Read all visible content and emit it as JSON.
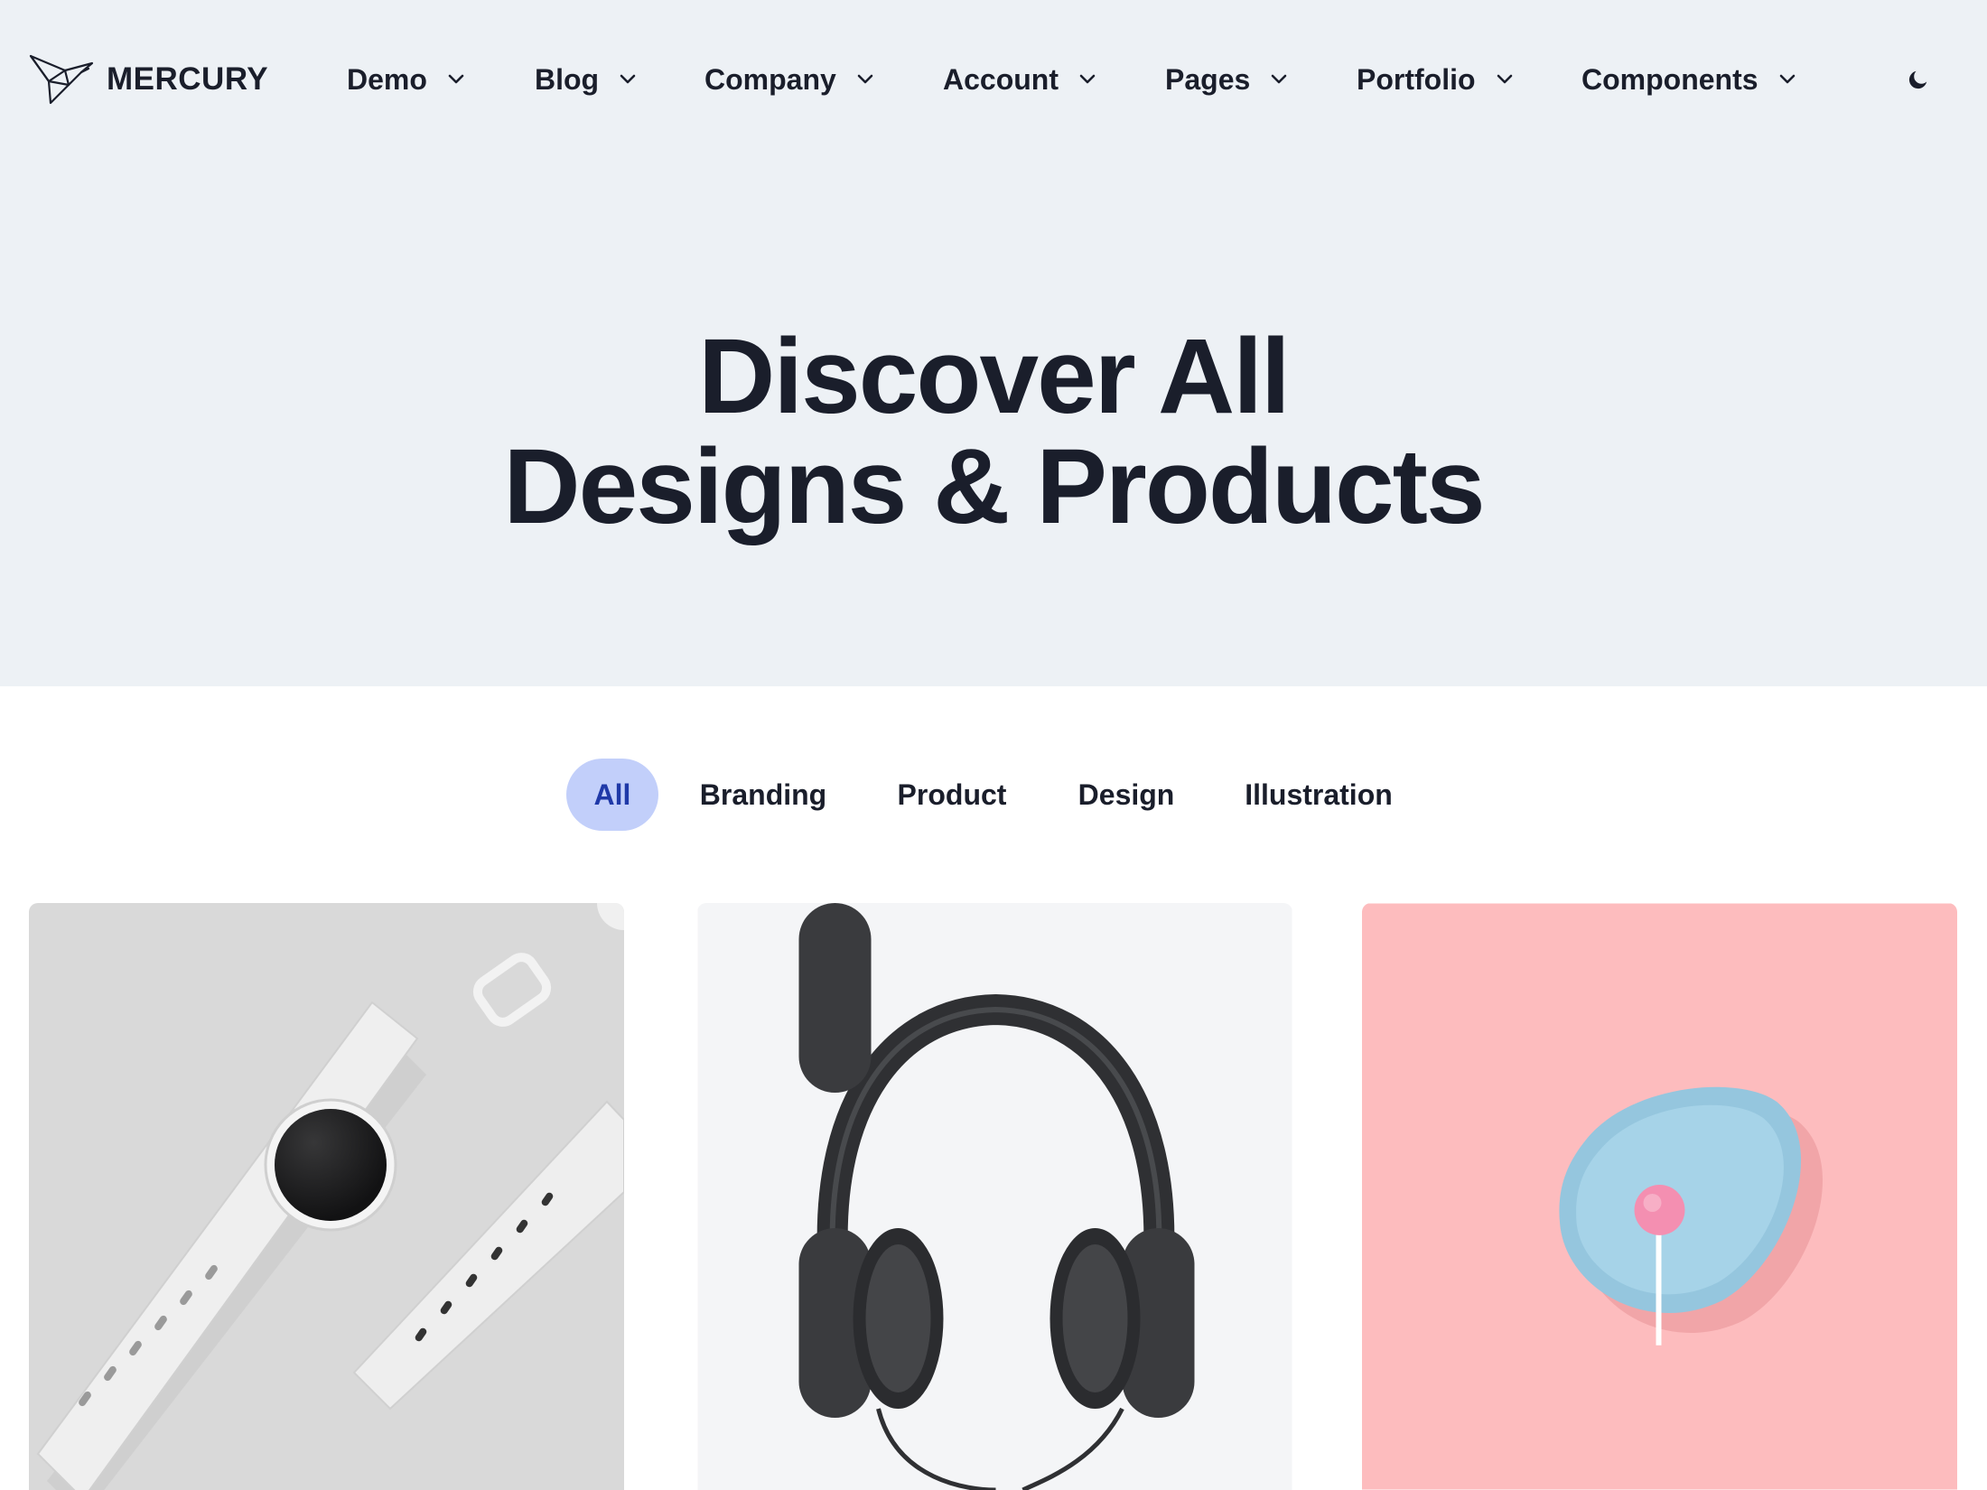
{
  "brand": {
    "name": "MERCURY",
    "logo_icon": "origami-bird-logo"
  },
  "nav": {
    "items": [
      {
        "label": "Demo",
        "icon": "chevron-down-icon"
      },
      {
        "label": "Blog",
        "icon": "chevron-down-icon"
      },
      {
        "label": "Company",
        "icon": "chevron-down-icon"
      },
      {
        "label": "Account",
        "icon": "chevron-down-icon"
      },
      {
        "label": "Pages",
        "icon": "chevron-down-icon"
      },
      {
        "label": "Portfolio",
        "icon": "chevron-down-icon"
      },
      {
        "label": "Components",
        "icon": "chevron-down-icon"
      }
    ],
    "theme_toggle_icon": "moon-icon"
  },
  "hero": {
    "title_line1": "Discover All",
    "title_line2": "Designs & Products"
  },
  "filters": {
    "items": [
      {
        "label": "All",
        "active": true
      },
      {
        "label": "Branding",
        "active": false
      },
      {
        "label": "Product",
        "active": false
      },
      {
        "label": "Design",
        "active": false
      },
      {
        "label": "Illustration",
        "active": false
      }
    ]
  },
  "portfolio": {
    "cards": [
      {
        "image": "smartwatch-product-photo"
      },
      {
        "image": "headphones-product-photo"
      },
      {
        "image": "lollipop-on-blue-plate-photo"
      }
    ]
  },
  "colors": {
    "hero_background": "#edf1f5",
    "text_primary": "#1a1e2b",
    "filter_active_background": "#c2cffa",
    "filter_active_text": "#1f39a8",
    "card_watch_background": "#d9d9d9",
    "card_headphones_background": "#f4f5f7",
    "card_lollipop_background": "#fdbcbe"
  }
}
